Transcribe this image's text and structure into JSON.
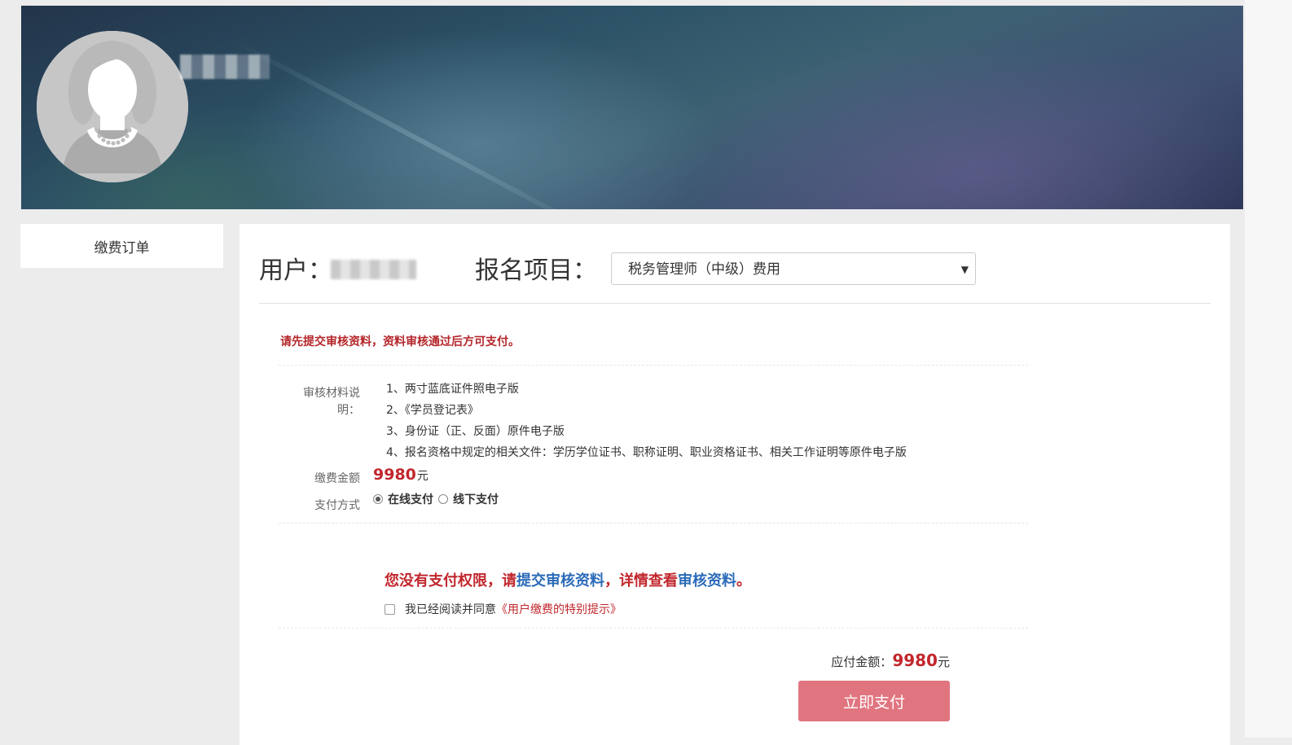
{
  "sidebar": {
    "menu_item": "缴费订单"
  },
  "header": {
    "user_label": "用户：",
    "project_label": "报名项目：",
    "project_selected": "税务管理师（中级）费用"
  },
  "notice": {
    "warning": "请先提交审核资料，资料审核通过后方可支付。"
  },
  "requirements": {
    "label": "审核材料说明：",
    "items": [
      "1、两寸蓝底证件照电子版",
      "2、《学员登记表》",
      "3、身份证（正、反面）原件电子版",
      "4、报名资格中规定的相关文件：学历学位证书、职称证明、职业资格证书、相关工作证明等原件电子版"
    ]
  },
  "fee": {
    "label": "缴费金额",
    "value": "9980",
    "unit": "元"
  },
  "payment": {
    "label": "支付方式",
    "options": [
      {
        "label": "在线支付",
        "selected": true
      },
      {
        "label": "线下支付",
        "selected": false
      }
    ]
  },
  "no_permission": {
    "part1": "您没有支付权限，请",
    "link1": "提交审核资料",
    "part2": "，详情查看",
    "link2": "审核资料",
    "part3": "。"
  },
  "agreement": {
    "text": "我已经阅读并同意",
    "link": "《用户缴费的特别提示》",
    "checked": false
  },
  "total": {
    "label": "应付金额：",
    "value": "9980",
    "unit": "元"
  },
  "pay_button": {
    "label": "立即支付"
  },
  "colors": {
    "accent_red": "#c1272d",
    "link_blue": "#2a6ab8",
    "button": "#e07580"
  }
}
